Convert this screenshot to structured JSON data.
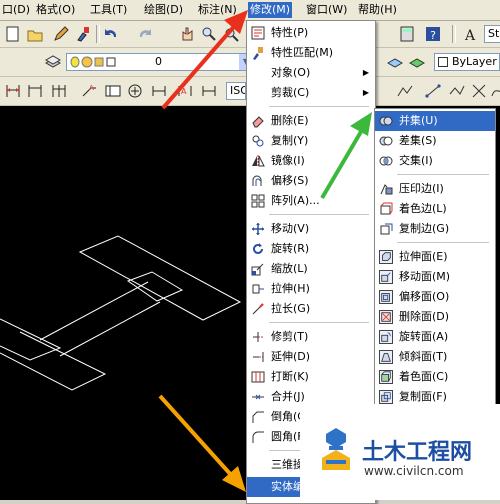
{
  "menubar": [
    {
      "label": "口(D)"
    },
    {
      "label": "格式(O)"
    },
    {
      "label": "工具(T)"
    },
    {
      "label": "绘图(D)"
    },
    {
      "label": "标注(N)"
    },
    {
      "label": "修改(M)"
    },
    {
      "label": "窗口(W)"
    },
    {
      "label": "帮助(H)"
    }
  ],
  "toolbar": {
    "layer_value": "0",
    "linetype_value": "ByLayer",
    "dimstyle_value": "ISO",
    "textstyle_value": "St"
  },
  "modify_menu": {
    "items": [
      {
        "label": "特性(P)",
        "icon": "properties-icon"
      },
      {
        "label": "特性匹配(M)",
        "icon": "match-properties-icon"
      },
      {
        "label": "对象(O)",
        "icon": "",
        "submenu": true
      },
      {
        "label": "剪裁(C)",
        "icon": "",
        "submenu": true
      },
      {
        "label": "删除(E)",
        "icon": "erase-icon"
      },
      {
        "label": "复制(Y)",
        "icon": "copy-icon"
      },
      {
        "label": "镜像(I)",
        "icon": "mirror-icon"
      },
      {
        "label": "偏移(S)",
        "icon": "offset-icon"
      },
      {
        "label": "阵列(A)...",
        "icon": "array-icon"
      },
      {
        "label": "移动(V)",
        "icon": "move-icon"
      },
      {
        "label": "旋转(R)",
        "icon": "rotate-icon"
      },
      {
        "label": "缩放(L)",
        "icon": "scale-icon"
      },
      {
        "label": "拉伸(H)",
        "icon": "stretch-icon"
      },
      {
        "label": "拉长(G)",
        "icon": "lengthen-icon"
      },
      {
        "label": "修剪(T)",
        "icon": "trim-icon"
      },
      {
        "label": "延伸(D)",
        "icon": "extend-icon"
      },
      {
        "label": "打断(K)",
        "icon": "break-icon"
      },
      {
        "label": "合并(J)",
        "icon": "join-icon"
      },
      {
        "label": "倒角(C)",
        "icon": "chamfer-icon"
      },
      {
        "label": "圆角(F)",
        "icon": "fillet-icon"
      },
      {
        "label": "三维操作",
        "icon": ""
      },
      {
        "label": "实体编辑",
        "icon": ""
      }
    ]
  },
  "solids_menu": {
    "items": [
      {
        "label": "并集(U)",
        "icon": "union-icon"
      },
      {
        "label": "差集(S)",
        "icon": "subtract-icon"
      },
      {
        "label": "交集(I)",
        "icon": "intersect-icon"
      },
      {
        "label": "压印边(I)",
        "icon": "imprint-icon"
      },
      {
        "label": "着色边(L)",
        "icon": "color-edges-icon"
      },
      {
        "label": "复制边(G)",
        "icon": "copy-edges-icon"
      },
      {
        "label": "拉伸面(E)",
        "icon": "extrude-faces-icon"
      },
      {
        "label": "移动面(M)",
        "icon": "move-faces-icon"
      },
      {
        "label": "偏移面(O)",
        "icon": "offset-faces-icon"
      },
      {
        "label": "删除面(D)",
        "icon": "delete-faces-icon"
      },
      {
        "label": "旋转面(A)",
        "icon": "rotate-faces-icon"
      },
      {
        "label": "倾斜面(T)",
        "icon": "taper-faces-icon"
      },
      {
        "label": "着色面(C)",
        "icon": "color-faces-icon"
      },
      {
        "label": "复制面(F)",
        "icon": "copy-faces-icon"
      }
    ]
  },
  "watermark": {
    "title": "土木工程网",
    "url": "www.civilcn.com"
  },
  "colors": {
    "red_arrow": "#e8301c",
    "green_arrow": "#3cb93c",
    "orange_arrow": "#f5a100",
    "highlight": "#316ac5"
  }
}
